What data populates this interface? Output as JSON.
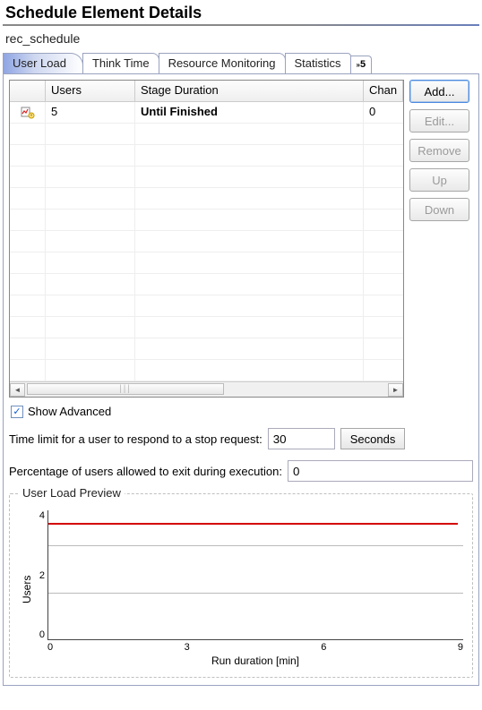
{
  "pageTitle": "Schedule Element Details",
  "scheduleName": "rec_schedule",
  "tabs": {
    "items": [
      "User Load",
      "Think Time",
      "Resource Monitoring",
      "Statistics"
    ],
    "overflowCount": "5",
    "activeIndex": 0
  },
  "grid": {
    "headers": [
      "",
      "Users",
      "Stage Duration",
      "Chan"
    ],
    "rows": [
      {
        "icon": "stage-icon",
        "users": "5",
        "duration": "Until Finished",
        "change": "0"
      }
    ]
  },
  "buttons": {
    "add": "Add...",
    "edit": "Edit...",
    "remove": "Remove",
    "up": "Up",
    "down": "Down"
  },
  "showAdvanced": {
    "label": "Show Advanced",
    "checked": true
  },
  "timeLimit": {
    "label": "Time limit for a user to respond to a stop request:",
    "value": "30",
    "unit": "Seconds"
  },
  "percentExit": {
    "label": "Percentage of users allowed to exit during execution:",
    "value": "0"
  },
  "preview": {
    "title": "User Load Preview",
    "ylabel": "Users",
    "xlabel": "Run duration [min]"
  },
  "chart_data": {
    "type": "line",
    "x": [
      0,
      3,
      6,
      9,
      10
    ],
    "y": [
      5,
      5,
      5,
      5,
      5
    ],
    "xticks": [
      0,
      3,
      6,
      9
    ],
    "yticks": [
      0,
      2,
      4
    ],
    "ylim": [
      0,
      5.5
    ],
    "xlim": [
      0,
      10
    ]
  }
}
